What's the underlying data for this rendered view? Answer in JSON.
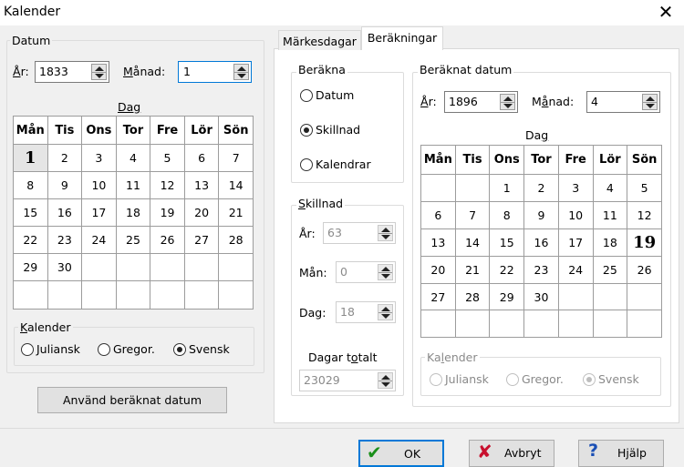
{
  "window": {
    "title": "Kalender",
    "close_glyph": "✕"
  },
  "datum": {
    "legend": "Datum",
    "ar_label": "År:",
    "ar_value": "1833",
    "manad_label": "Månad:",
    "manad_value": "1",
    "dag_label": "Dag",
    "calendar": {
      "headers": [
        "Mån",
        "Tis",
        "Ons",
        "Tor",
        "Fre",
        "Lör",
        "Sön"
      ],
      "rows": [
        [
          "1",
          "2",
          "3",
          "4",
          "5",
          "6",
          "7"
        ],
        [
          "8",
          "9",
          "10",
          "11",
          "12",
          "13",
          "14"
        ],
        [
          "15",
          "16",
          "17",
          "18",
          "19",
          "20",
          "21"
        ],
        [
          "22",
          "23",
          "24",
          "25",
          "26",
          "27",
          "28"
        ],
        [
          "29",
          "30",
          "",
          "",
          "",
          "",
          ""
        ],
        [
          "",
          "",
          "",
          "",
          "",
          "",
          ""
        ]
      ],
      "selected_day": "1"
    },
    "kalender_legend": "Kalender",
    "kalender_options": [
      "Juliansk",
      "Gregor.",
      "Svensk"
    ],
    "kalender_selected": "Svensk",
    "use_button": "Använd beräknat datum"
  },
  "tabs": [
    "Märkesdagar",
    "Beräkningar"
  ],
  "active_tab": "Beräkningar",
  "berakna": {
    "legend": "Beräkna",
    "options": [
      "Datum",
      "Skillnad",
      "Kalendrar"
    ],
    "selected": "Skillnad"
  },
  "skillnad": {
    "legend": "Skillnad",
    "ar_label": "År:",
    "ar_value": "63",
    "man_label": "Mån:",
    "man_value": "0",
    "dag_label": "Dag:",
    "dag_value": "18",
    "totalt_label": "Dagar totalt",
    "totalt_value": "23029"
  },
  "beraknat": {
    "legend": "Beräknat datum",
    "ar_label": "År:",
    "ar_value": "1896",
    "manad_label": "Månad:",
    "manad_value": "4",
    "dag_label": "Dag",
    "calendar": {
      "headers": [
        "Mån",
        "Tis",
        "Ons",
        "Tor",
        "Fre",
        "Lör",
        "Sön"
      ],
      "rows": [
        [
          "",
          "",
          "1",
          "2",
          "3",
          "4",
          "5"
        ],
        [
          "6",
          "7",
          "8",
          "9",
          "10",
          "11",
          "12"
        ],
        [
          "13",
          "14",
          "15",
          "16",
          "17",
          "18",
          "19"
        ],
        [
          "20",
          "21",
          "22",
          "23",
          "24",
          "25",
          "26"
        ],
        [
          "27",
          "28",
          "29",
          "30",
          "",
          "",
          ""
        ],
        [
          "",
          "",
          "",
          "",
          "",
          "",
          ""
        ]
      ],
      "selected_day": "19"
    },
    "kalender_legend": "Kalender",
    "kalender_options": [
      "Juliansk",
      "Gregor.",
      "Svensk"
    ],
    "kalender_selected": "Svensk"
  },
  "buttons": {
    "ok": "OK",
    "avbryt": "Avbryt",
    "hjalp": "Hjälp"
  }
}
